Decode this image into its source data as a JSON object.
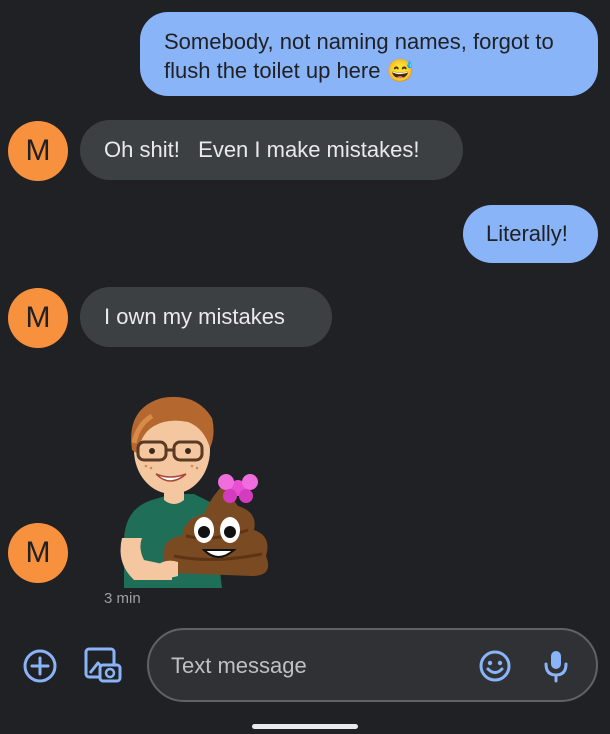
{
  "messages": [
    {
      "direction": "outgoing",
      "text": "Somebody, not naming names, forgot to flush the toilet up here 😅"
    },
    {
      "direction": "incoming",
      "sender_initial": "M",
      "text": "Oh shit!   Even I make mistakes!"
    },
    {
      "direction": "outgoing",
      "text": "Literally!"
    },
    {
      "direction": "incoming",
      "sender_initial": "M",
      "text": "I own my mistakes"
    },
    {
      "direction": "incoming",
      "sender_initial": "M",
      "type": "sticker",
      "sticker": "bitmoji-poop-sticker",
      "timestamp": "3 min"
    }
  ],
  "compose": {
    "placeholder": "Text message",
    "add_icon": "add-circle-icon",
    "gallery_icon": "gallery-icon",
    "emoji_icon": "emoji-icon",
    "mic_icon": "microphone-icon"
  },
  "colors": {
    "background": "#202124",
    "outgoing_bubble": "#8ab4f8",
    "incoming_bubble": "#3c4043",
    "avatar": "#f8913d",
    "accent": "#8ab4f8"
  }
}
